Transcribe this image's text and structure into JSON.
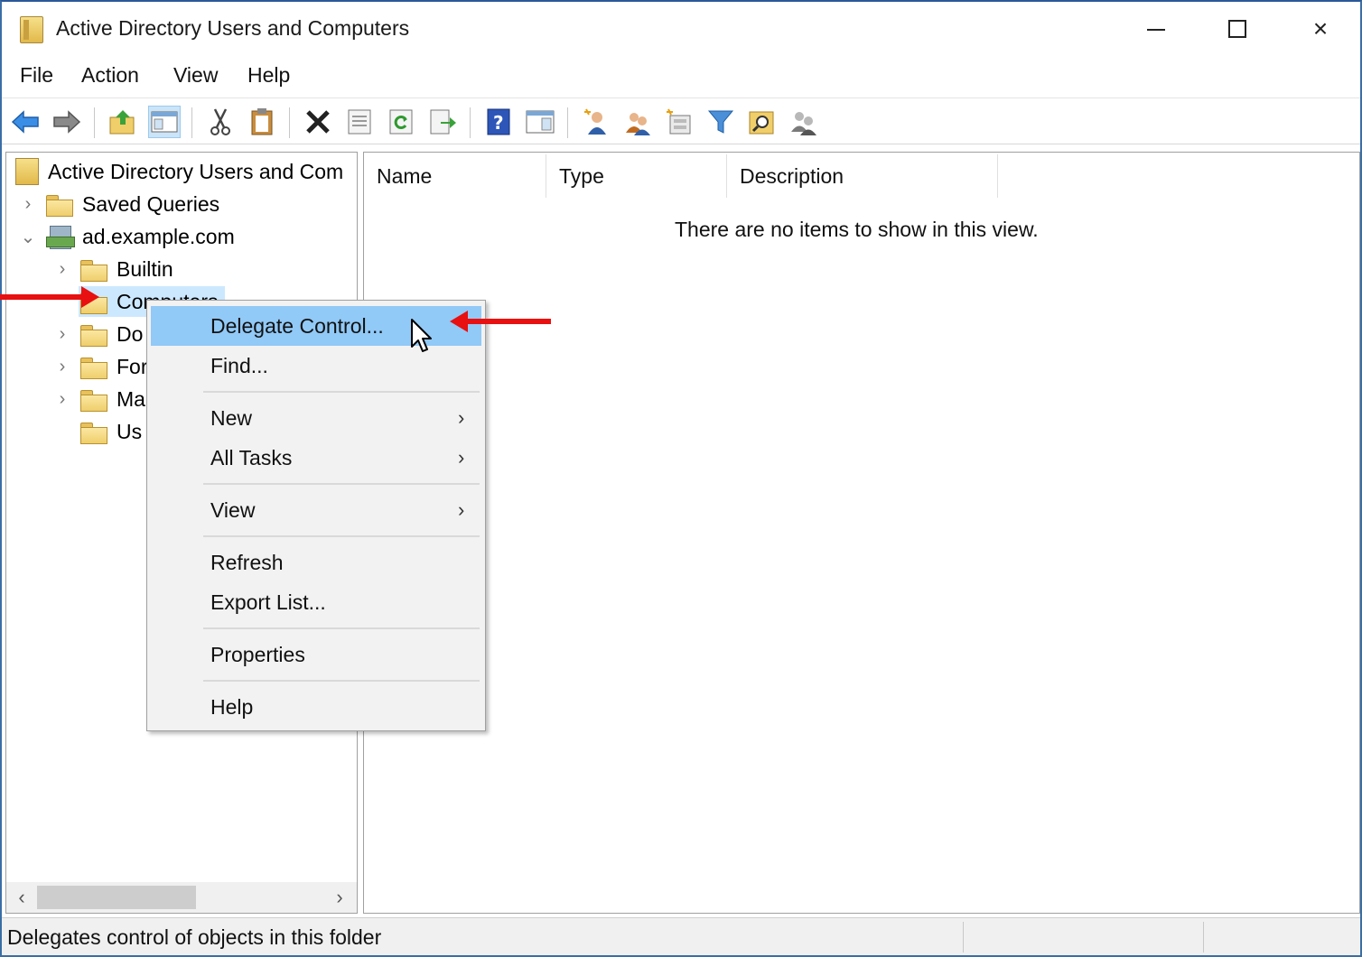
{
  "window": {
    "title": "Active Directory Users and Computers",
    "controls": {
      "minimize": "minimize",
      "maximize": "maximize",
      "close": "×"
    }
  },
  "menubar": [
    "File",
    "Action",
    "View",
    "Help"
  ],
  "toolbar": {
    "buttons": [
      "back-icon",
      "forward-icon",
      "up-folder-icon",
      "show-console-tree-icon",
      "cut-icon",
      "paste-icon",
      "delete-icon",
      "properties-icon",
      "refresh-icon",
      "export-list-icon",
      "help-icon",
      "show-action-pane-icon",
      "new-user-icon",
      "new-group-icon",
      "new-ou-icon",
      "filter-icon",
      "find-icon",
      "add-to-group-icon"
    ]
  },
  "tree": {
    "root": "Active Directory Users and Com",
    "items": [
      {
        "label": "Saved Queries",
        "expander": "›"
      },
      {
        "label": "ad.example.com",
        "expander": "⌄"
      },
      {
        "label": "Builtin",
        "expander": "›"
      },
      {
        "label": "Computers",
        "expander": ""
      },
      {
        "label": "Do",
        "expander": "›"
      },
      {
        "label": "For",
        "expander": "›"
      },
      {
        "label": "Ma",
        "expander": "›"
      },
      {
        "label": "Us",
        "expander": ""
      }
    ],
    "scroll_left": "‹",
    "scroll_right": "›"
  },
  "list": {
    "columns": [
      "Name",
      "Type",
      "Description"
    ],
    "empty_message": "There are no items to show in this view."
  },
  "context_menu": {
    "items": [
      {
        "label": "Delegate Control...",
        "submenu": false,
        "highlighted": true
      },
      {
        "label": "Find...",
        "submenu": false
      },
      {
        "label": "New",
        "submenu": true
      },
      {
        "label": "All Tasks",
        "submenu": true
      },
      {
        "label": "View",
        "submenu": true
      },
      {
        "label": "Refresh",
        "submenu": false
      },
      {
        "label": "Export List...",
        "submenu": false
      },
      {
        "label": "Properties",
        "submenu": false
      },
      {
        "label": "Help",
        "submenu": false
      }
    ],
    "submenu_arrow": "›"
  },
  "status": {
    "text": "Delegates control of objects in this folder"
  },
  "colors": {
    "highlight": "#91c9f7",
    "annotation": "#e81010",
    "selection": "#cce8ff"
  }
}
